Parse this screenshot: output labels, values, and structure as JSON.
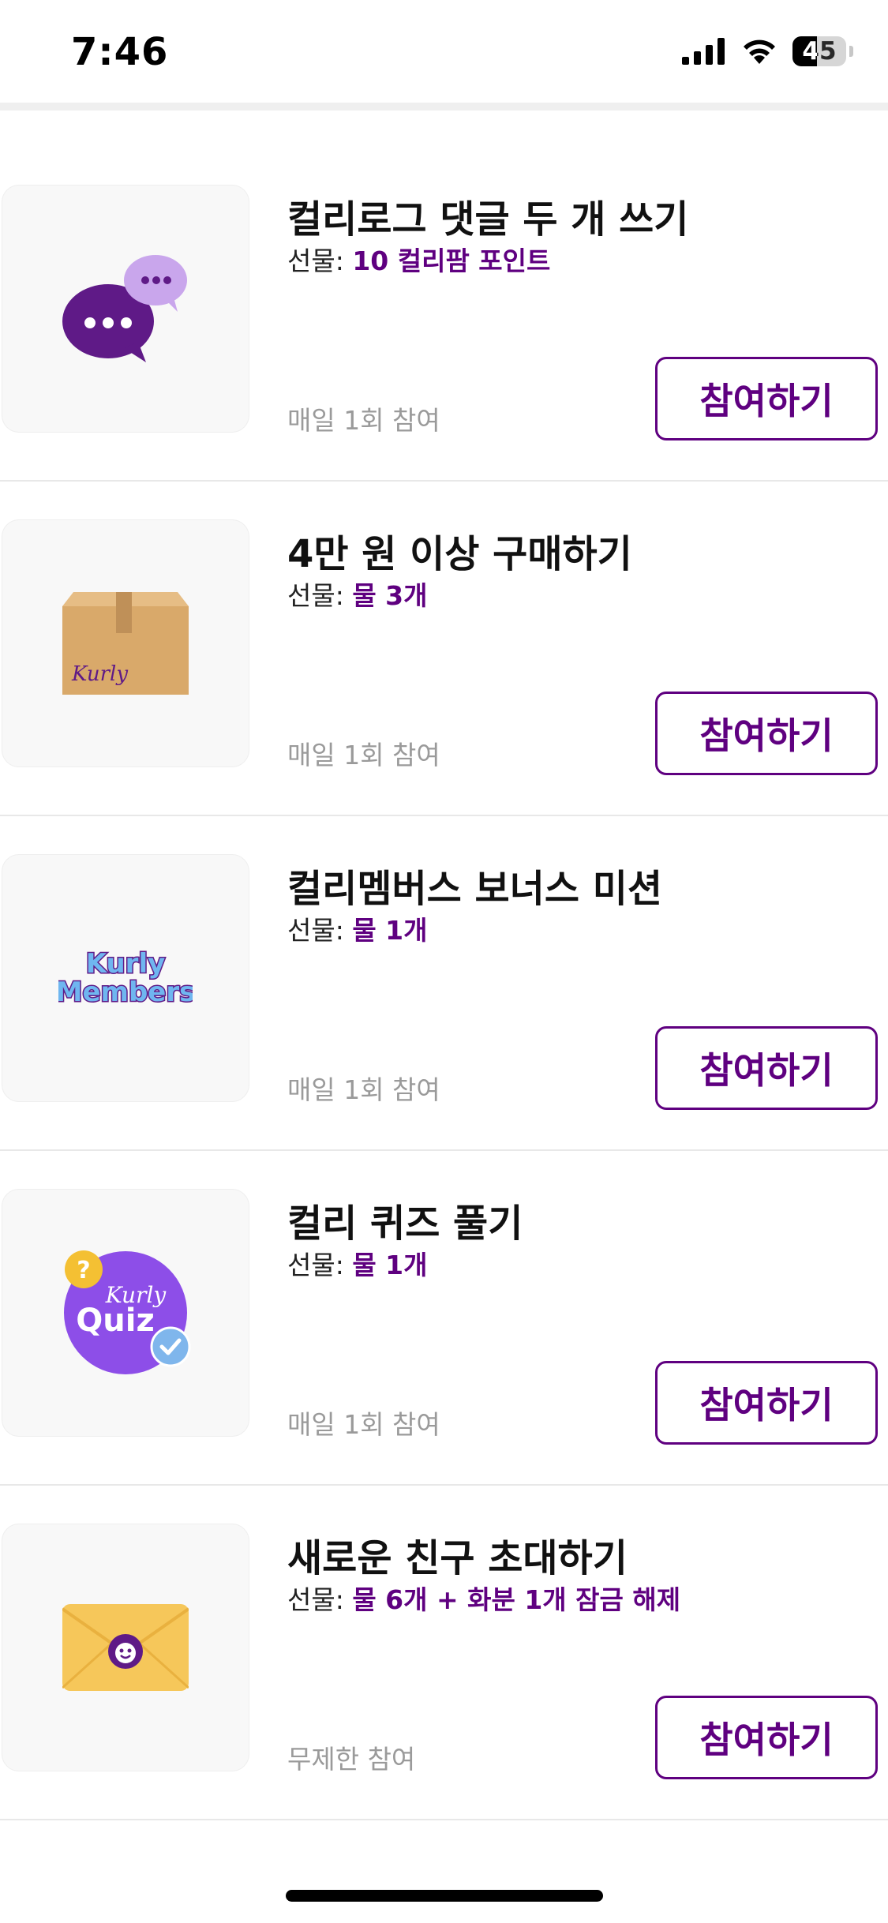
{
  "status_bar": {
    "time": "7:46",
    "battery": "45",
    "battery_level": 0.45
  },
  "reward_label": "선물: ",
  "missions": [
    {
      "title": "컬리로그 댓글 두 개 쓰기",
      "reward": "10 컬리팜 포인트",
      "frequency": "매일 1회 참여",
      "button": "참여하기",
      "icon": "chat-bubbles-icon"
    },
    {
      "title": "4만 원 이상 구매하기",
      "reward": "물 3개",
      "frequency": "매일 1회 참여",
      "button": "참여하기",
      "icon": "kurly-box-icon",
      "icon_text": "Kurly"
    },
    {
      "title": "컬리멤버스 보너스 미션",
      "reward": "물 1개",
      "frequency": "매일 1회 참여",
      "button": "참여하기",
      "icon": "kurly-members-logo",
      "icon_text_1": "Kurly",
      "icon_text_2": "Members"
    },
    {
      "title": "컬리 퀴즈 풀기",
      "reward": "물 1개",
      "frequency": "매일 1회 참여",
      "button": "참여하기",
      "icon": "kurly-quiz-icon",
      "icon_text_1": "Kurly",
      "icon_text_2": "Quiz"
    },
    {
      "title": "새로운 친구 초대하기",
      "reward": "물 6개 + 화분 1개 잠금 해제",
      "frequency": "무제한 참여",
      "button": "참여하기",
      "icon": "invite-envelope-icon"
    }
  ],
  "colors": {
    "accent": "#5f0080",
    "muted_text": "#9a9a9a",
    "divider": "#e8e8e8"
  }
}
